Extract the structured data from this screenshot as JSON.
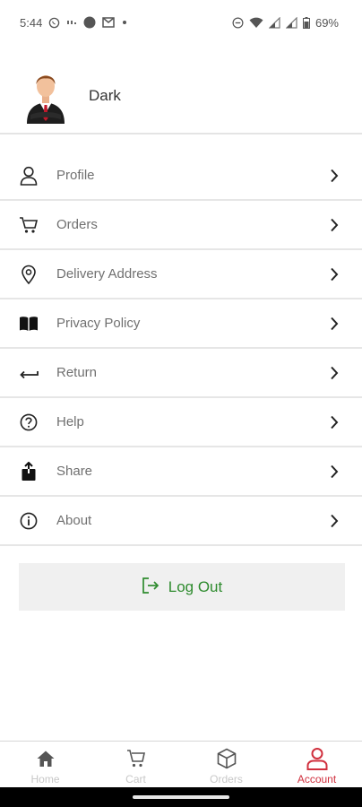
{
  "status_bar": {
    "time": "5:44",
    "battery": "69%",
    "icons": [
      "whatsapp-icon",
      "network-text-icon",
      "record-dot-icon",
      "gmail-icon",
      "notification-dot-icon",
      "dnd-icon",
      "wifi-icon",
      "signal-icon",
      "signal-icon",
      "battery-icon"
    ]
  },
  "profile": {
    "name": "Dark",
    "avatar_icon": "businessman-avatar"
  },
  "menu": {
    "items": [
      {
        "label": "Profile",
        "icon": "user-icon"
      },
      {
        "label": "Orders",
        "icon": "cart-icon"
      },
      {
        "label": "Delivery Address",
        "icon": "location-pin-icon"
      },
      {
        "label": "Privacy Policy",
        "icon": "book-icon"
      },
      {
        "label": "Return",
        "icon": "return-arrow-icon"
      },
      {
        "label": "Help",
        "icon": "help-icon"
      },
      {
        "label": "Share",
        "icon": "share-icon"
      },
      {
        "label": "About",
        "icon": "info-icon"
      }
    ]
  },
  "logout": {
    "label": "Log Out",
    "color": "#2e8b2e"
  },
  "bottom_nav": {
    "items": [
      {
        "label": "Home",
        "icon": "home-icon",
        "active": false
      },
      {
        "label": "Cart",
        "icon": "cart-icon",
        "active": false
      },
      {
        "label": "Orders",
        "icon": "box-icon",
        "active": false
      },
      {
        "label": "Account",
        "icon": "account-icon",
        "active": true
      }
    ],
    "active_color": "#d0303e",
    "inactive_color": "#c8c8c8"
  }
}
